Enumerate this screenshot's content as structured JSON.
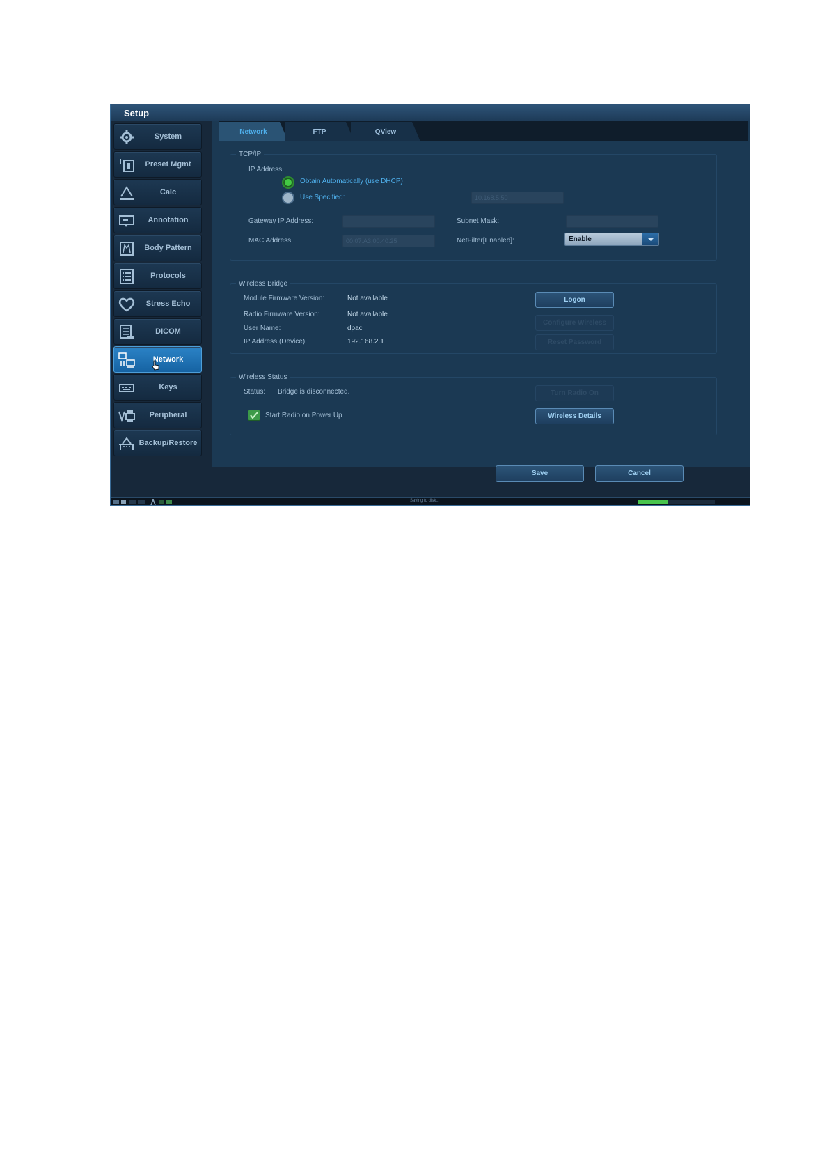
{
  "window": {
    "title": "Setup"
  },
  "sidebar": {
    "items": [
      {
        "label": "System",
        "icon": "gear-icon"
      },
      {
        "label": "Preset Mgmt",
        "icon": "preset-icon"
      },
      {
        "label": "Calc",
        "icon": "calc-icon"
      },
      {
        "label": "Annotation",
        "icon": "annotation-icon"
      },
      {
        "label": "Body Pattern",
        "icon": "body-pattern-icon"
      },
      {
        "label": "Protocols",
        "icon": "protocols-icon"
      },
      {
        "label": "Stress Echo",
        "icon": "heart-icon"
      },
      {
        "label": "DICOM",
        "icon": "dicom-icon"
      },
      {
        "label": "Network",
        "icon": "network-icon",
        "active": true
      },
      {
        "label": "Keys",
        "icon": "keys-icon"
      },
      {
        "label": "Peripheral",
        "icon": "peripheral-icon"
      },
      {
        "label": "Backup/Restore",
        "icon": "backup-icon"
      }
    ]
  },
  "tabs": [
    {
      "label": "Network",
      "active": true
    },
    {
      "label": "FTP"
    },
    {
      "label": "QView"
    }
  ],
  "tcpip": {
    "legend": "TCP/IP",
    "ip_address_label": "IP Address:",
    "dhcp_option": "Obtain Automatically (use DHCP)",
    "specified_option": "Use Specified:",
    "specified_ip": "10.168.5.50",
    "gateway_label": "Gateway IP Address:",
    "gateway_value": "",
    "subnet_label": "Subnet Mask:",
    "subnet_value": "",
    "mac_label": "MAC Address:",
    "mac_value": "00:07:A3:00:40:25",
    "netfilter_label": "NetFilter[Enabled]:",
    "netfilter_value": "Enable"
  },
  "wireless_bridge": {
    "legend": "Wireless Bridge",
    "module_fw_label": "Module Firmware Version:",
    "module_fw_value": "Not available",
    "radio_fw_label": "Radio Firmware Version:",
    "radio_fw_value": "Not available",
    "user_label": "User Name:",
    "user_value": "dpac",
    "ip_label": "IP Address (Device):",
    "ip_value": "192.168.2.1",
    "logon_button": "Logon",
    "configure_button": "Configure Wireless",
    "reset_button": "Reset Password"
  },
  "wireless_status": {
    "legend": "Wireless Status",
    "status_label": "Status:",
    "status_value": "Bridge is disconnected.",
    "radio_on_button": "Turn Radio On",
    "start_radio_label": "Start Radio on Power Up",
    "start_radio_checked": true,
    "details_button": "Wireless Details"
  },
  "footer": {
    "save_button": "Save",
    "cancel_button": "Cancel"
  },
  "taskbar": {
    "status_text": "Saving to disk...",
    "progress": 0.38
  },
  "colors": {
    "accent": "#2b83c7",
    "active_tab_text": "#4fb0ec",
    "radio_on": "#43c944",
    "progress": "#48c44c"
  }
}
